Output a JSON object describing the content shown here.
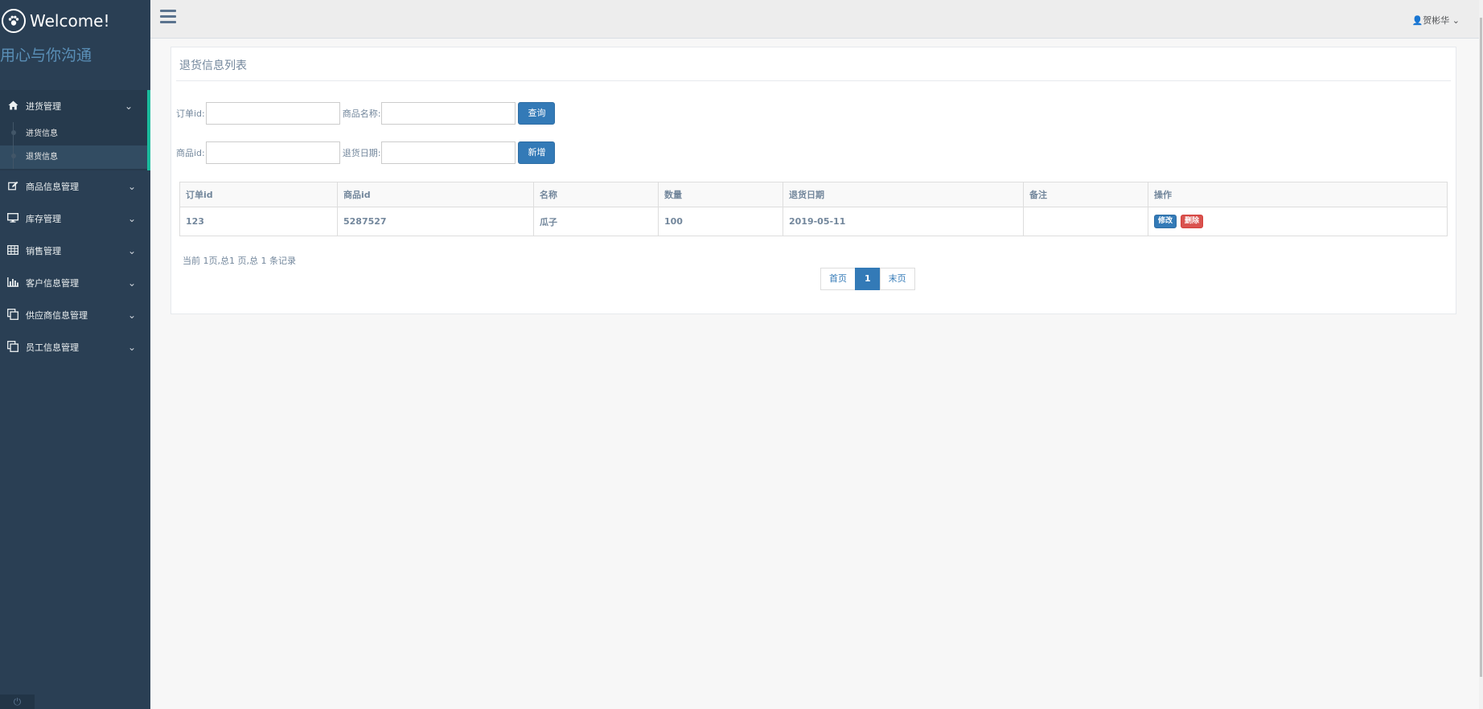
{
  "brand": {
    "title": "Welcome!",
    "icon": "paw-icon",
    "slogan": "用心与你沟通"
  },
  "sidebar": {
    "menus": [
      {
        "label": "进货管理",
        "icon": "home-icon",
        "active": true,
        "children": [
          {
            "label": "进货信息"
          },
          {
            "label": "退货信息",
            "selected": true
          }
        ]
      },
      {
        "label": "商品信息管理",
        "icon": "edit-icon"
      },
      {
        "label": "库存管理",
        "icon": "desktop-icon"
      },
      {
        "label": "销售管理",
        "icon": "table-icon"
      },
      {
        "label": "客户信息管理",
        "icon": "bar-chart-icon"
      },
      {
        "label": "供应商信息管理",
        "icon": "clone-icon"
      },
      {
        "label": "员工信息管理",
        "icon": "clone-icon"
      }
    ],
    "footer_icon": "power-icon"
  },
  "topbar": {
    "user": "贺彬华",
    "user_icon": "user-icon"
  },
  "panel": {
    "title": "退货信息列表",
    "form": {
      "order_id_label": "订单id:",
      "product_name_label": "商品名称:",
      "search_button": "查询",
      "product_id_label": "商品id:",
      "return_date_label": "退货日期:",
      "add_button": "新增",
      "order_id_value": "",
      "product_name_value": "",
      "product_id_value": "",
      "return_date_value": ""
    },
    "table": {
      "headers": [
        "订单id",
        "商品id",
        "名称",
        "数量",
        "退货日期",
        "备注",
        "操作"
      ],
      "rows": [
        {
          "order_id": "123",
          "product_id": "5287527",
          "name": "瓜子",
          "qty": "100",
          "date": "2019-05-11",
          "note": "",
          "edit": "修改",
          "delete": "删除"
        }
      ]
    },
    "record_info": "当前 1页,总1 页,总 1 条记录",
    "pager": {
      "first": "首页",
      "current": "1",
      "last": "末页"
    }
  },
  "colors": {
    "sidebar": "#2a3f54",
    "accent": "#1abb9c",
    "primary": "#337ab7",
    "danger": "#d9534f"
  }
}
